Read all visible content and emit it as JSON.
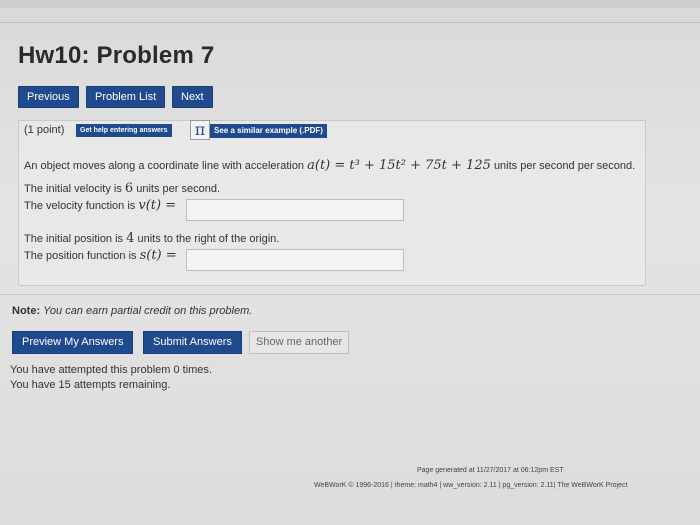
{
  "header": {
    "title": "Hw10: Problem 7"
  },
  "nav": {
    "previous": "Previous",
    "problem_list": "Problem List",
    "next": "Next"
  },
  "problem": {
    "points": "(1 point)",
    "help_label": "Get help entering answers",
    "pi_symbol": "π",
    "similar_example": "See a similar example (.PDF)",
    "statement_pre": "An object moves along a coordinate line with acceleration",
    "statement_math": "a(t) = t³ + 15t² + 75t + 125",
    "statement_post": "units per second per second.",
    "initial_velocity_pre": "The initial velocity is",
    "initial_velocity_value": "6",
    "initial_velocity_post": "units per second.",
    "velocity_label": "The velocity function is",
    "velocity_math": "v(t) =",
    "velocity_answer": "",
    "initial_position_pre": "The initial position is",
    "initial_position_value": "4",
    "initial_position_post": "units to the right of the origin.",
    "position_label": "The position function is",
    "position_math": "s(t) =",
    "position_answer": ""
  },
  "note": {
    "label": "Note:",
    "text": "You can earn partial credit on this problem."
  },
  "actions": {
    "preview": "Preview My Answers",
    "submit": "Submit Answers",
    "show_another": "Show me another"
  },
  "attempts": {
    "attempted": "You have attempted this problem 0 times.",
    "remaining": "You have 15 attempts remaining."
  },
  "footer": {
    "generated": "Page generated at 11/27/2017 at 06:12pm EST",
    "copyright": "WeBWorK © 1996-2016 | theme: math4 | ww_version: 2.11 | pg_version: 2.11| The WeBWorK Project"
  },
  "colors": {
    "button_blue": "#1f4a8d",
    "background": "#e4e4e4"
  }
}
